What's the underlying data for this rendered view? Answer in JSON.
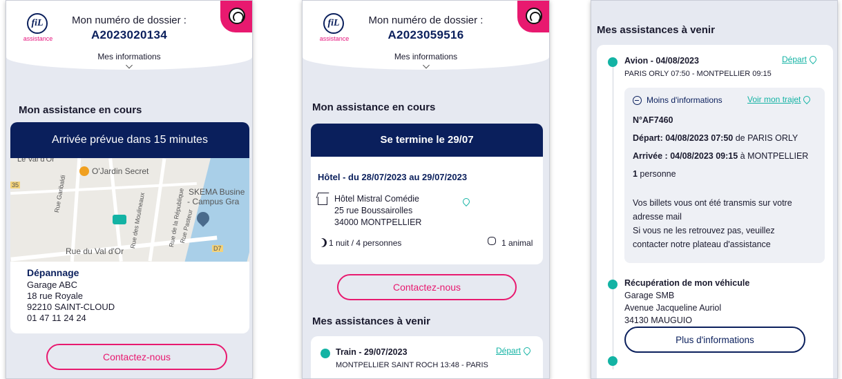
{
  "panel1": {
    "logo_text": "fiL",
    "logo_sub": "assistance",
    "dossier_label": "Mon numéro de dossier :",
    "dossier_number": "A2023020134",
    "mes_informations": "Mes informations",
    "section_title": "Mon assistance en cours",
    "banner": "Arrivée prévue dans 15 minutes",
    "map_labels": {
      "val_dor_top": "Le Val d'Or",
      "ojardin": "O'Jardin Secret",
      "skema": "SKEMA Busine",
      "campus": "- Campus Gra",
      "rue_val_dor": "Rue du Val d'Or",
      "rue_garibaldi": "Rue Garibaldi",
      "rue_moulineaux": "Rue des Moulineaux",
      "rue_republique": "Rue de la République",
      "rue_pasteur": "Rue Pasteur",
      "d7": "D7",
      "num35": "35"
    },
    "service_title": "Dépannage",
    "address": [
      "Garage ABC",
      "18 rue Royale",
      "92210 SAINT-CLOUD",
      "01 47 11 24 24"
    ],
    "contact_button": "Contactez-nous"
  },
  "panel2": {
    "logo_text": "fiL",
    "logo_sub": "assistance",
    "dossier_label": "Mon numéro de dossier :",
    "dossier_number": "A2023059516",
    "mes_informations": "Mes informations",
    "section_title": "Mon assistance en cours",
    "banner": "Se termine le 29/07",
    "hotel_title": "Hôtel - du 28/07/2023 au 29/07/2023",
    "hotel_address": [
      "Hôtel Mistral Comédie",
      "25 rue Boussairolles",
      "34000 MONTPELLIER"
    ],
    "nights": "1 nuit / 4 personnes",
    "animals": "1 animal",
    "contact_button": "Contactez-nous",
    "upcoming_title": "Mes assistances à venir",
    "train_title": "Train - 29/07/2023",
    "train_link": "Départ",
    "train_route": "MONTPELLIER SAINT ROCH 13:48 - PARIS"
  },
  "panel3": {
    "upcoming_title": "Mes assistances à venir",
    "plane_title": "Avion - 04/08/2023",
    "plane_link": "Départ",
    "plane_route": "PARIS ORLY 07:50 - MONTPELLIER 09:15",
    "less_info": "Moins d'informations",
    "voir_trajet": "Voir mon trajet",
    "flight_number": "N°AF7460",
    "depart_label": "Départ: 04/08/2023 07:50",
    "depart_rest": " de PARIS ORLY",
    "arrivee_label": "Arrivée : 04/08/2023 09:15",
    "arrivee_rest": " à MONTPELLIER",
    "persons_num": "1",
    "persons_rest": " personne",
    "tickets_lines": [
      "Vos billets vous ont été transmis sur votre",
      "adresse mail",
      "Si vous ne les retrouvez pas, veuillez",
      "contacter notre plateau d'assistance"
    ],
    "vehicle_title": "Récupération de mon véhicule",
    "vehicle_address": [
      "Garage SMB",
      "Avenue Jacqueline Auriol",
      "34130 MAUGUIO"
    ],
    "more_info_button": "Plus d'informations"
  },
  "colors": {
    "navy": "#0a1f5c",
    "pink": "#e8196f",
    "teal": "#13b3a4",
    "bg": "#e6e9f1"
  }
}
